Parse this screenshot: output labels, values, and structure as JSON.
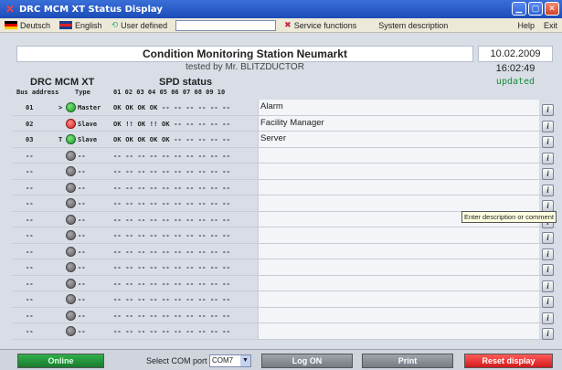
{
  "window": {
    "title": "DRC MCM XT Status Display"
  },
  "menu": {
    "deutsch": "Deutsch",
    "english": "English",
    "user_defined": "User defined",
    "service_functions": "Service functions",
    "system_description": "System description",
    "help": "Help",
    "exit": "Exit"
  },
  "header": {
    "station": "Condition Monitoring Station Neumarkt",
    "datetime": "10.02.2009  16:02:49",
    "tested_by": "tested by Mr. BLITZDUCTOR",
    "status": "updated"
  },
  "labels": {
    "device": "DRC MCM XT",
    "spd_status": "SPD status",
    "col_bus": "Bus address",
    "col_type": "Type",
    "col_spd": "01 02 03 04 05 06 07 08 09 10"
  },
  "rows": [
    {
      "addr": "01",
      "mark": ">",
      "status": "green",
      "type": "Master",
      "spd": "OK OK OK OK -- -- -- -- -- --",
      "desc": "Alarm"
    },
    {
      "addr": "02",
      "mark": "",
      "status": "red",
      "type": "Slave",
      "spd": "OK !! OK !! OK -- -- -- -- --",
      "desc": "Facility Manager"
    },
    {
      "addr": "03",
      "mark": "T",
      "status": "green",
      "type": "Slave",
      "spd": "OK OK OK OK OK -- -- -- -- --",
      "desc": "Server"
    },
    {
      "addr": "--",
      "mark": "",
      "status": "gray",
      "type": "--",
      "spd": "-- -- -- -- -- -- -- -- -- --",
      "desc": ""
    },
    {
      "addr": "--",
      "mark": "",
      "status": "gray",
      "type": "--",
      "spd": "-- -- -- -- -- -- -- -- -- --",
      "desc": ""
    },
    {
      "addr": "--",
      "mark": "",
      "status": "gray",
      "type": "--",
      "spd": "-- -- -- -- -- -- -- -- -- --",
      "desc": ""
    },
    {
      "addr": "--",
      "mark": "",
      "status": "gray",
      "type": "--",
      "spd": "-- -- -- -- -- -- -- -- -- --",
      "desc": ""
    },
    {
      "addr": "--",
      "mark": "",
      "status": "gray",
      "type": "--",
      "spd": "-- -- -- -- -- -- -- -- -- --",
      "desc": ""
    },
    {
      "addr": "--",
      "mark": "",
      "status": "gray",
      "type": "--",
      "spd": "-- -- -- -- -- -- -- -- -- --",
      "desc": ""
    },
    {
      "addr": "--",
      "mark": "",
      "status": "gray",
      "type": "--",
      "spd": "-- -- -- -- -- -- -- -- -- --",
      "desc": ""
    },
    {
      "addr": "--",
      "mark": "",
      "status": "gray",
      "type": "--",
      "spd": "-- -- -- -- -- -- -- -- -- --",
      "desc": ""
    },
    {
      "addr": "--",
      "mark": "",
      "status": "gray",
      "type": "--",
      "spd": "-- -- -- -- -- -- -- -- -- --",
      "desc": ""
    },
    {
      "addr": "--",
      "mark": "",
      "status": "gray",
      "type": "--",
      "spd": "-- -- -- -- -- -- -- -- -- --",
      "desc": ""
    },
    {
      "addr": "--",
      "mark": "",
      "status": "gray",
      "type": "--",
      "spd": "-- -- -- -- -- -- -- -- -- --",
      "desc": ""
    },
    {
      "addr": "--",
      "mark": "",
      "status": "gray",
      "type": "--",
      "spd": "-- -- -- -- -- -- -- -- -- --",
      "desc": ""
    }
  ],
  "tooltip": "Enter description or comment",
  "bottom": {
    "online": "Online",
    "com_label": "Select COM port",
    "com_value": "COM7",
    "log_on": "Log ON",
    "print": "Print",
    "reset": "Reset display"
  },
  "colors": {
    "online": "#1a7a2e",
    "reset": "#d21b1b",
    "updated": "#1a8a3a"
  }
}
